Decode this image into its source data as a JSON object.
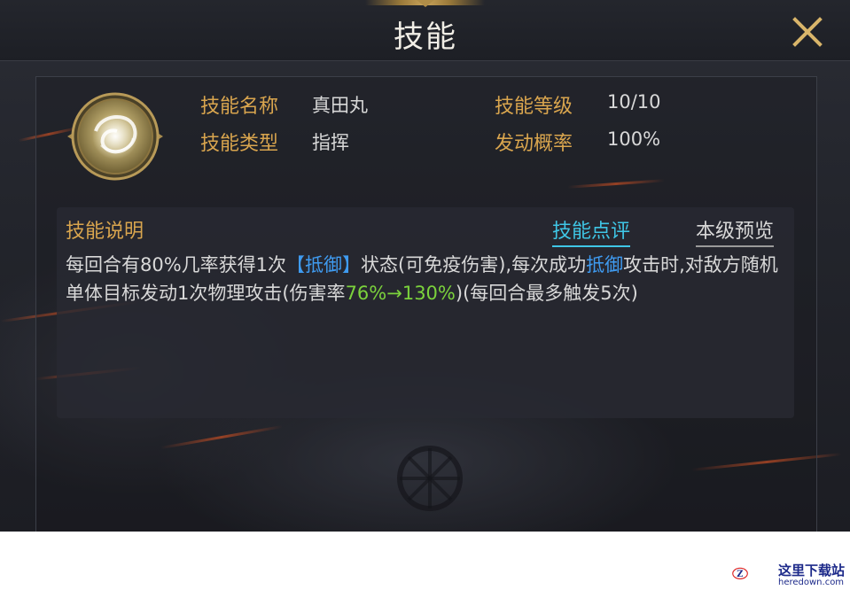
{
  "header": {
    "title": "技能",
    "close_icon": "close-icon"
  },
  "skill": {
    "icon": "swirl-orb-icon",
    "name_label": "技能名称",
    "name_value": "真田丸",
    "type_label": "技能类型",
    "type_value": "指挥",
    "level_label": "技能等级",
    "level_value": "10/10",
    "trigger_label": "发动概率",
    "trigger_value": "100%"
  },
  "description": {
    "title": "技能说明",
    "tab_review": "技能点评",
    "tab_preview": "本级预览",
    "seg1": "每回合有80%几率获得1次",
    "kw1": "【抵御】",
    "seg2": "状态(可免疫伤害),每次成功",
    "kw2": "抵御",
    "seg3": "攻击时,对敌方随机单体目标发动1次物理攻击(伤害率",
    "kw3": "76%→130%",
    "seg4": ")(每回合最多触发5次)"
  },
  "colors": {
    "label_gold": "#d9a54e",
    "value_text": "#d8d8d8",
    "highlight_blue": "#3f9bf0",
    "highlight_green": "#7bd23c",
    "active_tab": "#3fc6e6"
  },
  "watermark": {
    "title": "这里下载站",
    "url": "heredown.com",
    "logo": "z-logo-icon"
  }
}
